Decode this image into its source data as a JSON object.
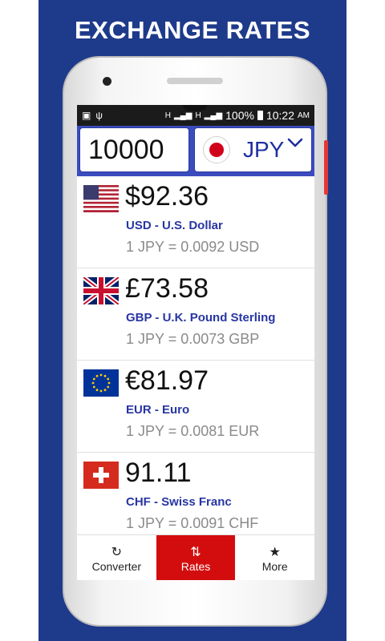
{
  "promo_title": "EXCHANGE RATES",
  "status_bar": {
    "signal_text": "H",
    "battery": "100%",
    "time": "10:22",
    "ampm": "AM"
  },
  "input": {
    "amount": "10000",
    "currency": "JPY",
    "currency_flag_icon": "japan-flag-icon"
  },
  "rates": [
    {
      "amount": "$92.36",
      "name": "USD - U.S. Dollar",
      "rate": "1 JPY = 0.0092 USD",
      "flag_icon": "us-flag-icon"
    },
    {
      "amount": "£73.58",
      "name": "GBP - U.K. Pound Sterling",
      "rate": "1 JPY = 0.0073 GBP",
      "flag_icon": "uk-flag-icon"
    },
    {
      "amount": "€81.97",
      "name": "EUR - Euro",
      "rate": "1 JPY = 0.0081 EUR",
      "flag_icon": "eu-flag-icon"
    },
    {
      "amount": "91.11",
      "name": "CHF - Swiss Franc",
      "rate": "1 JPY = 0.0091 CHF",
      "flag_icon": "swiss-flag-icon"
    }
  ],
  "nav": [
    {
      "label": "Converter",
      "icon": "refresh-icon"
    },
    {
      "label": "Rates",
      "icon": "swap-vertical-icon",
      "active": true
    },
    {
      "label": "More",
      "icon": "star-icon"
    }
  ],
  "colors": {
    "promo_background": "#1e3a8a",
    "input_bar": "#3b4cbf",
    "accent_text": "#2836a3",
    "active_tab": "#d30d0d"
  }
}
